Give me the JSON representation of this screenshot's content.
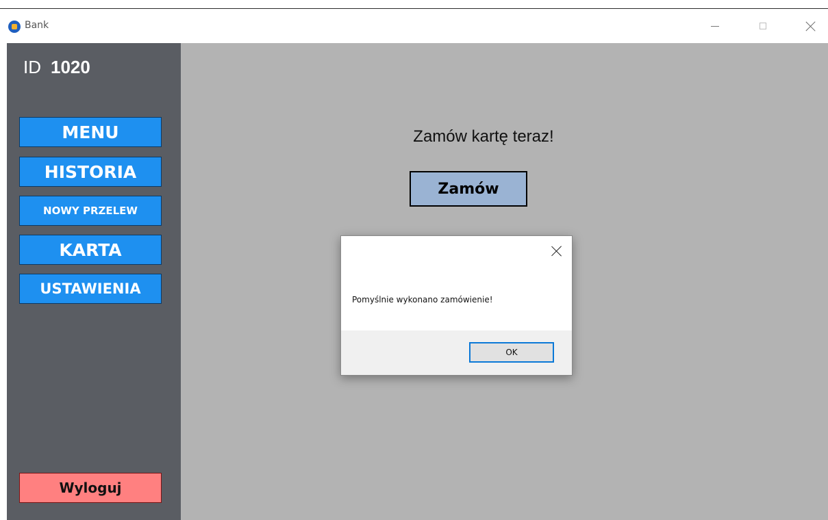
{
  "window": {
    "title": "Bank",
    "icon": "bank-app-icon",
    "controls": {
      "minimize_icon": "minimize-icon",
      "maximize_icon": "maximize-icon",
      "close_icon": "close-icon"
    }
  },
  "sidebar": {
    "id_label": "ID",
    "id_value": "1020",
    "nav": {
      "menu": "MENU",
      "historia": "HISTORIA",
      "nowy_przelew": "NOWY PRZELEW",
      "karta": "KARTA",
      "ustawienia": "USTAWIENIA"
    },
    "logout": "Wyloguj"
  },
  "main": {
    "heading": "Zamów kartę teraz!",
    "order_button": "Zamów"
  },
  "dialog": {
    "message": "Pomyślnie wykonano zamówienie!",
    "ok_button": "OK"
  },
  "colors": {
    "sidebar_bg": "#5a5d63",
    "nav_button_bg": "#1e90f0",
    "logout_bg": "#ff8080",
    "main_bg": "#b3b3b3",
    "order_button_bg": "#9ab3d3",
    "dialog_accent": "#0a78d7"
  }
}
